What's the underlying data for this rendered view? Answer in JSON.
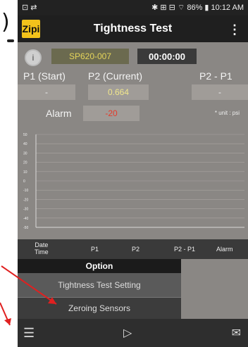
{
  "fragments": {
    "paren": ")"
  },
  "statusbar": {
    "left": "⊡ ⇄",
    "right": "✱ ⊞ ⊟ ⌔ 86% ▮ 10:12 AM"
  },
  "appbar": {
    "logo": "Zipi",
    "title": "Tightness Test",
    "menu": "⋮"
  },
  "top": {
    "info_icon": "i",
    "serial": "SP620-007",
    "timer": "00:00:00"
  },
  "readings": {
    "p1_label": "P1 (Start)",
    "p2_label": "P2 (Current)",
    "diff_label": "P2 - P1",
    "p1_value": "-",
    "p2_value": "0.664",
    "diff_value": "-"
  },
  "alarm": {
    "label": "Alarm",
    "value": "-20",
    "unit_note": "* unit : psi"
  },
  "chart_data": {
    "type": "line",
    "y_ticks": [
      "50",
      "40",
      "30",
      "20",
      "10",
      "0",
      "-10",
      "-20",
      "-30",
      "-40",
      "-50"
    ],
    "ylim": [
      -50,
      50
    ],
    "series": []
  },
  "table": {
    "headers": [
      "Date\nTime",
      "P1",
      "P2",
      "P2 - P1",
      "Alarm"
    ]
  },
  "dropdown": {
    "title": "Option",
    "items": [
      "Tightness Test Setting",
      "Zeroing Sensors"
    ]
  },
  "bottombar": {
    "list_icon": "☰",
    "play_icon": "▷",
    "mail_icon": "✉"
  },
  "colors": {
    "content_bg": "#8a8784",
    "alarm_value": "#e53a2a",
    "serial_text": "#e6d55a",
    "annotation_arrow": "#e02020"
  }
}
